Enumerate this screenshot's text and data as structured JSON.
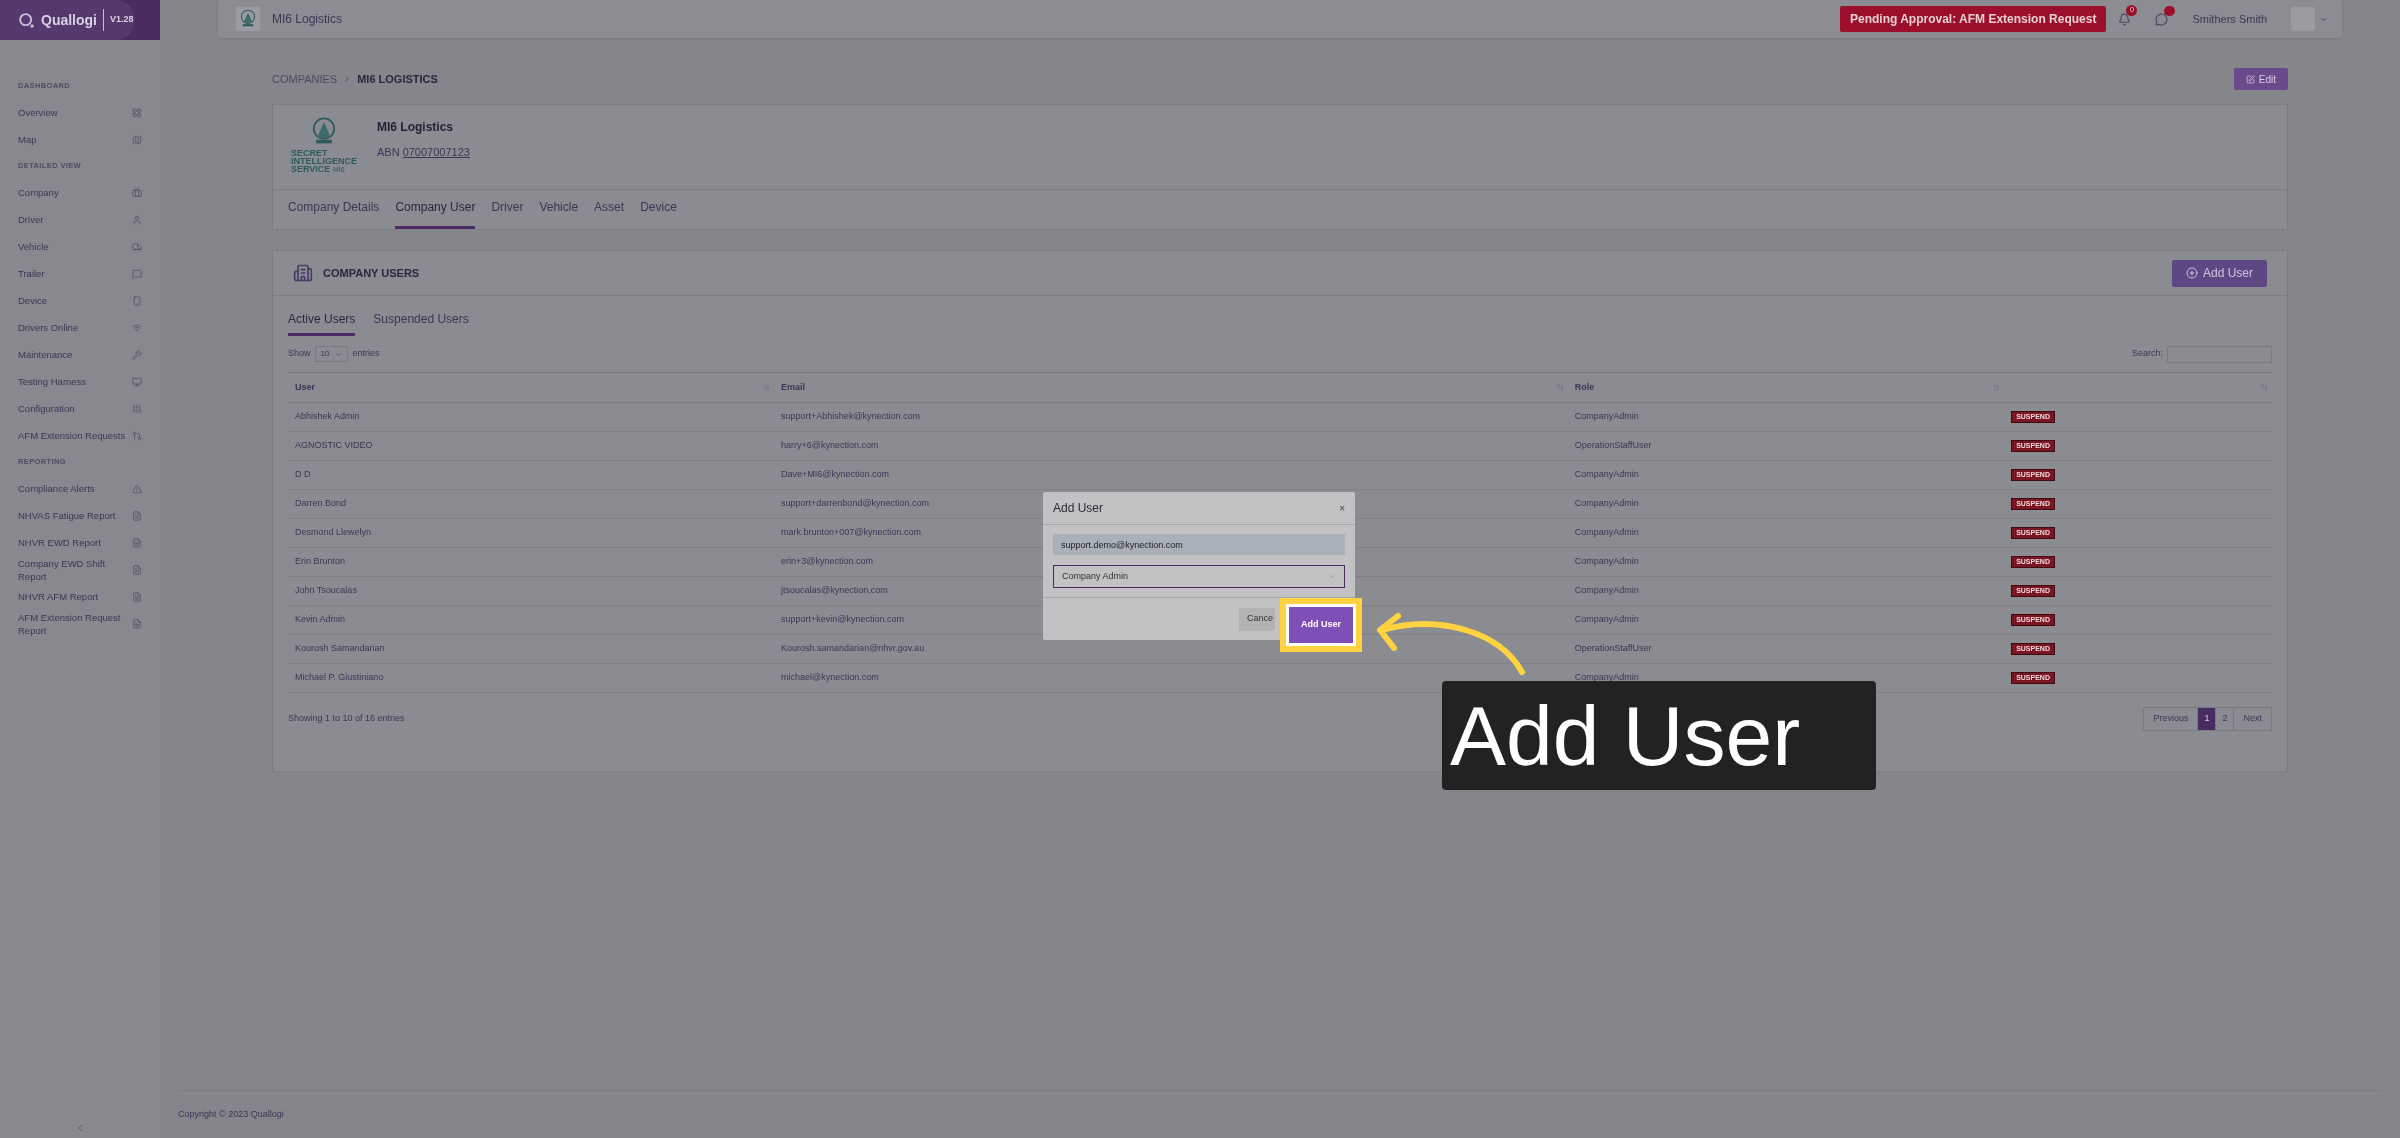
{
  "sidebar": {
    "brand": "Quallogi",
    "version": "V1.28",
    "sections": [
      {
        "title": "DASHBOARD",
        "items": [
          {
            "label": "Overview"
          },
          {
            "label": "Map"
          }
        ]
      },
      {
        "title": "DETAILED VIEW",
        "items": [
          {
            "label": "Company"
          },
          {
            "label": "Driver"
          },
          {
            "label": "Vehicle"
          },
          {
            "label": "Trailer"
          },
          {
            "label": "Device"
          },
          {
            "label": "Drivers Online"
          },
          {
            "label": "Maintenance"
          },
          {
            "label": "Testing Harness"
          },
          {
            "label": "Configuration"
          },
          {
            "label": "AFM Extension Requests"
          }
        ]
      },
      {
        "title": "REPORTING",
        "items": [
          {
            "label": "Compliance Alerts"
          },
          {
            "label": "NHVAS Fatigue Report"
          },
          {
            "label": "NHVR EWD Report"
          },
          {
            "label": "Company EWD Shift Report"
          },
          {
            "label": "NHVR AFM Report"
          },
          {
            "label": "AFM Extension Request Report"
          }
        ]
      }
    ]
  },
  "topbar": {
    "company": "MI6 Logistics",
    "pending_button": "Pending Approval: AFM Extension Request",
    "notification_count": "0",
    "user_name": "Smithers Smith"
  },
  "breadcrumb": {
    "parent": "COMPANIES",
    "current": "MI6 LOGISTICS"
  },
  "edit_button": "Edit",
  "company": {
    "logo_text": "SECRET INTELLIGENCE SERVICE",
    "logo_suffix": "MI6",
    "name": "MI6 Logistics",
    "abn_label": "ABN",
    "abn": "07007007123",
    "tabs": [
      {
        "label": "Company Details",
        "selected": false
      },
      {
        "label": "Company User",
        "selected": true
      },
      {
        "label": "Driver",
        "selected": false
      },
      {
        "label": "Vehicle",
        "selected": false
      },
      {
        "label": "Asset",
        "selected": false
      },
      {
        "label": "Device",
        "selected": false
      }
    ]
  },
  "users_panel": {
    "title": "COMPANY USERS",
    "add_button": "Add User",
    "tabs": [
      {
        "label": "Active Users",
        "selected": true
      },
      {
        "label": "Suspended Users",
        "selected": false
      }
    ],
    "show_label": "Show",
    "page_size": "10",
    "entries_label": "entries",
    "search_label": "Search:",
    "table": {
      "columns": [
        "User",
        "Email",
        "Role"
      ],
      "rows": [
        {
          "user": "Abhishek Admin",
          "email": "support+Abhishek@kynection.com",
          "role": "CompanyAdmin",
          "action": "SUSPEND"
        },
        {
          "user": "AGNOSTIC VIDEO",
          "email": "harry+6@kynection.com",
          "role": "OperationStaffUser",
          "action": "SUSPEND"
        },
        {
          "user": "D D",
          "email": "Dave+MI6@kynection.com",
          "role": "CompanyAdmin",
          "action": "SUSPEND"
        },
        {
          "user": "Darren Bond",
          "email": "support+darrenbond@kynection.com",
          "role": "CompanyAdmin",
          "action": "SUSPEND"
        },
        {
          "user": "Desmond Llewelyn",
          "email": "mark.brunton+007@kynection.com",
          "role": "CompanyAdmin",
          "action": "SUSPEND"
        },
        {
          "user": "Erin Brunton",
          "email": "erin+3@kynection.com",
          "role": "CompanyAdmin",
          "action": "SUSPEND"
        },
        {
          "user": "John Tsoucalas",
          "email": "jtsoucalas@kynection.com",
          "role": "CompanyAdmin",
          "action": "SUSPEND"
        },
        {
          "user": "Kevin Admin",
          "email": "support+kevin@kynection.com",
          "role": "CompanyAdmin",
          "action": "SUSPEND"
        },
        {
          "user": "Kourosh Samandarian",
          "email": "Kourosh.samandarian@nhvr.gov.au",
          "role": "OperationStaffUser",
          "action": "SUSPEND"
        },
        {
          "user": "Michael P. Giustiniano",
          "email": "michael@kynection.com",
          "role": "CompanyAdmin",
          "action": "SUSPEND"
        }
      ]
    },
    "info": "Showing 1 to 10 of 16 entries",
    "pagination": [
      {
        "label": "Previous",
        "kind": "nav",
        "selected": false
      },
      {
        "label": "1",
        "kind": "page",
        "selected": true
      },
      {
        "label": "2",
        "kind": "page",
        "selected": false
      },
      {
        "label": "Next",
        "kind": "nav",
        "selected": false
      }
    ]
  },
  "footer": "Copyright © 2023 Quallogi",
  "modal": {
    "title": "Add User",
    "close": "×",
    "email": "support.demo@kynection.com",
    "role": "Company Admin",
    "cancel_button": "Cance",
    "submit_button": "Add User"
  },
  "callout": "Add User"
}
